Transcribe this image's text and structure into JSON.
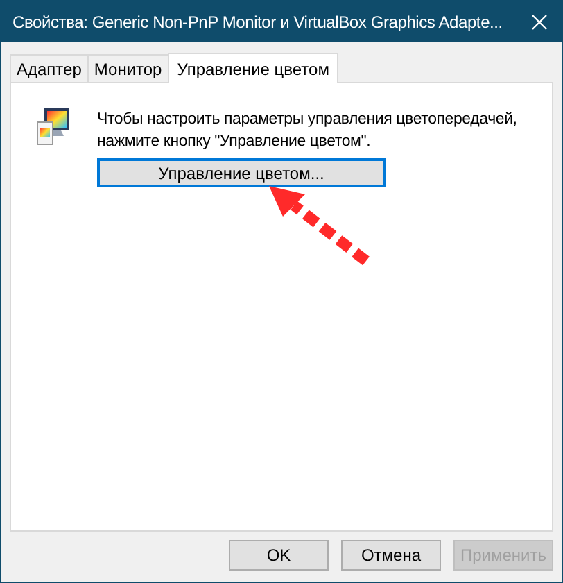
{
  "window": {
    "title": "Свойства: Generic Non-PnP Monitor и VirtualBox Graphics Adapte..."
  },
  "tabs": [
    {
      "label": "Адаптер",
      "selected": false
    },
    {
      "label": "Монитор",
      "selected": false
    },
    {
      "label": "Управление цветом",
      "selected": true
    }
  ],
  "description": "Чтобы настроить параметры управления цветопередачей, нажмите кнопку \"Управление цветом\".",
  "color_button": {
    "label": "Управление цветом...",
    "focused": true
  },
  "buttons": [
    {
      "label": "OK",
      "disabled": false
    },
    {
      "label": "Отмена",
      "disabled": false
    },
    {
      "label": "Применить",
      "disabled": true
    }
  ]
}
